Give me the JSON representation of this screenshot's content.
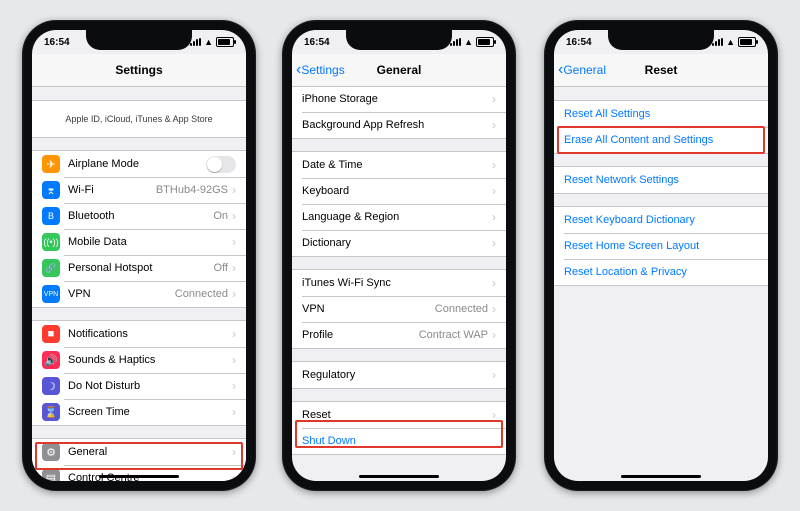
{
  "statusbar": {
    "time": "16:54"
  },
  "highlight_color": "#e0382b",
  "screens": {
    "settings": {
      "title": "Settings",
      "apple_id_hint": "Apple ID, iCloud, iTunes & App Store",
      "group_radios": [
        {
          "name": "airplane",
          "label": "Airplane Mode",
          "value": "",
          "type": "toggle"
        },
        {
          "name": "wifi",
          "label": "Wi-Fi",
          "value": "BTHub4-92GS",
          "type": "link"
        },
        {
          "name": "bluetooth",
          "label": "Bluetooth",
          "value": "On",
          "type": "link"
        },
        {
          "name": "mobile",
          "label": "Mobile Data",
          "value": "",
          "type": "link"
        },
        {
          "name": "hotspot",
          "label": "Personal Hotspot",
          "value": "Off",
          "type": "link"
        },
        {
          "name": "vpn",
          "label": "VPN",
          "value": "Connected",
          "type": "link"
        }
      ],
      "group_prefs": [
        {
          "name": "notifications",
          "label": "Notifications"
        },
        {
          "name": "sounds",
          "label": "Sounds & Haptics"
        },
        {
          "name": "dnd",
          "label": "Do Not Disturb"
        },
        {
          "name": "screentime",
          "label": "Screen Time"
        }
      ],
      "group_system": [
        {
          "name": "general",
          "label": "General"
        },
        {
          "name": "controlcentre",
          "label": "Control Centre"
        }
      ]
    },
    "general": {
      "back": "Settings",
      "title": "General",
      "group_a": [
        {
          "label": "iPhone Storage"
        },
        {
          "label": "Background App Refresh"
        }
      ],
      "group_b": [
        {
          "label": "Date & Time"
        },
        {
          "label": "Keyboard"
        },
        {
          "label": "Language & Region"
        },
        {
          "label": "Dictionary"
        }
      ],
      "group_c": [
        {
          "label": "iTunes Wi-Fi Sync"
        },
        {
          "label": "VPN",
          "value": "Connected"
        },
        {
          "label": "Profile",
          "value": "Contract WAP"
        }
      ],
      "group_d": [
        {
          "label": "Regulatory"
        }
      ],
      "group_e": [
        {
          "label": "Reset"
        }
      ],
      "shutdown": "Shut Down"
    },
    "reset": {
      "back": "General",
      "title": "Reset",
      "group_a": [
        {
          "label": "Reset All Settings"
        },
        {
          "label": "Erase All Content and Settings"
        }
      ],
      "group_b": [
        {
          "label": "Reset Network Settings"
        }
      ],
      "group_c": [
        {
          "label": "Reset Keyboard Dictionary"
        },
        {
          "label": "Reset Home Screen Layout"
        },
        {
          "label": "Reset Location & Privacy"
        }
      ]
    }
  }
}
